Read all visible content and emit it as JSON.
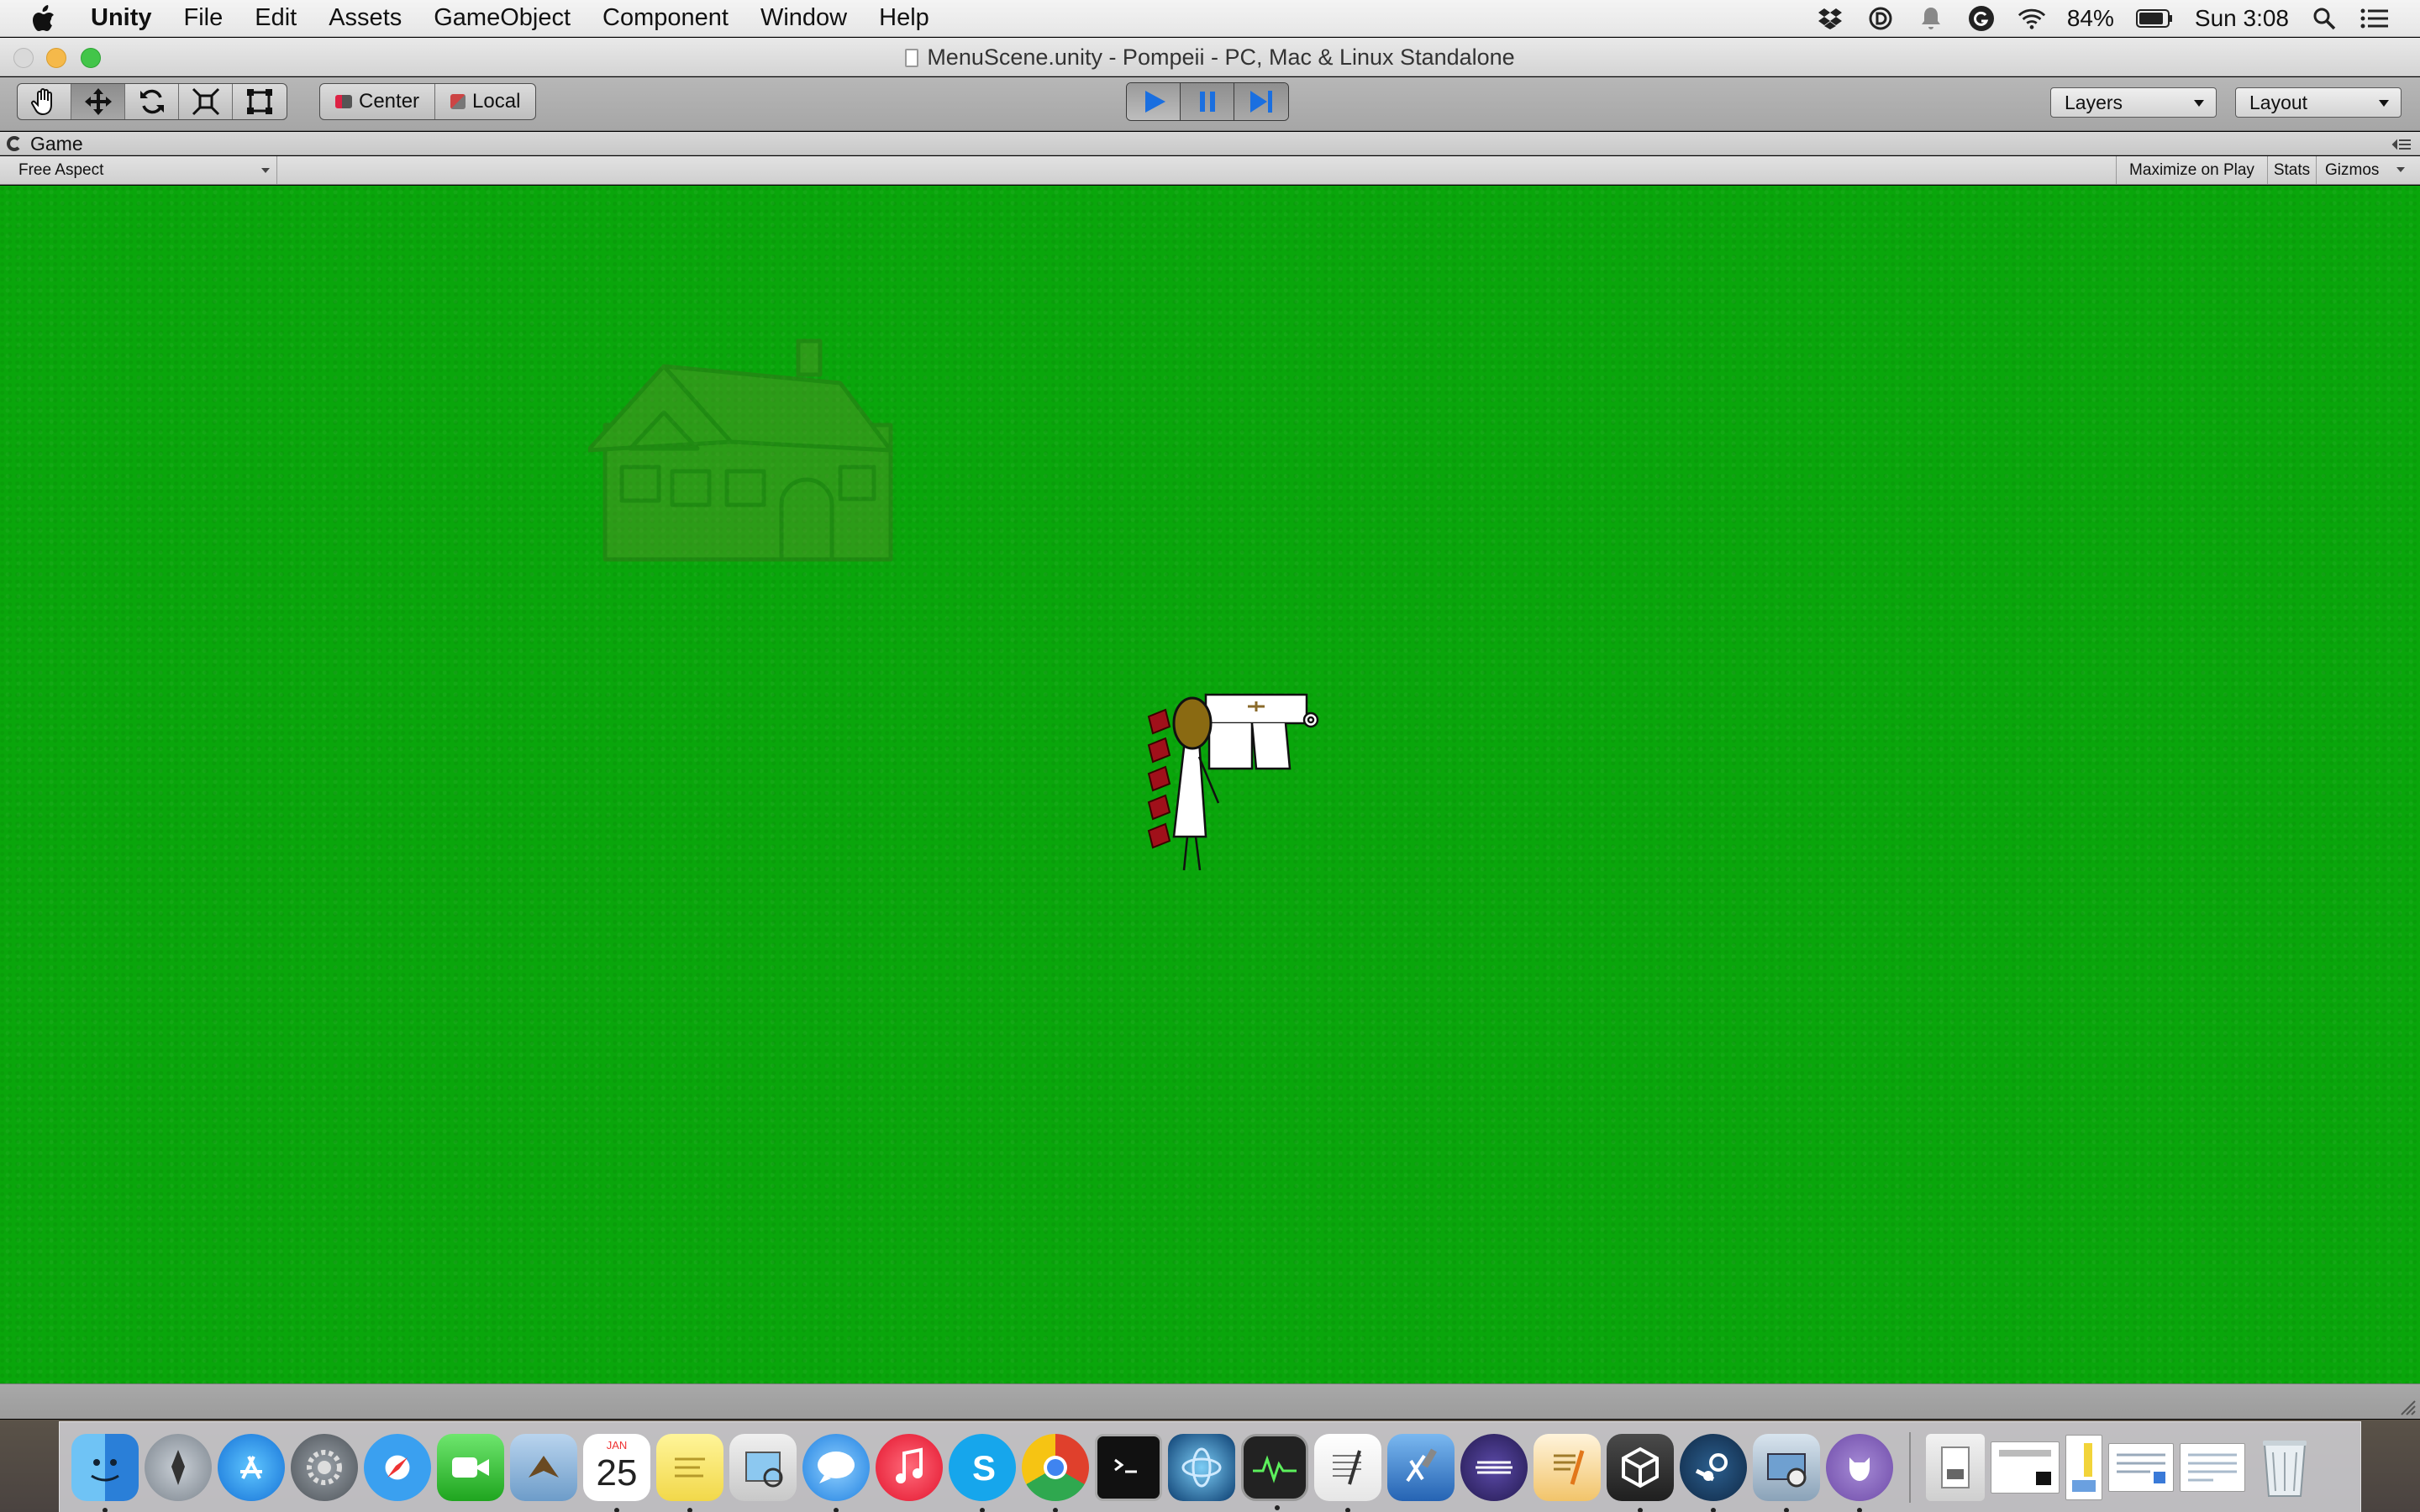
{
  "menubar": {
    "app_name": "Unity",
    "menus": [
      "File",
      "Edit",
      "Assets",
      "GameObject",
      "Component",
      "Window",
      "Help"
    ],
    "battery_percent": "84%",
    "clock": "Sun 3:08"
  },
  "window": {
    "title": "MenuScene.unity - Pompeii - PC, Mac & Linux Standalone"
  },
  "toolbar": {
    "pivot_label": "Center",
    "space_label": "Local",
    "layers_label": "Layers",
    "layout_label": "Layout",
    "play_state": "playing"
  },
  "game_view": {
    "tab_label": "Game",
    "aspect_label": "Free Aspect",
    "maximize_label": "Maximize on Play",
    "stats_label": "Stats",
    "gizmos_label": "Gizmos",
    "background_color": "#09a60b"
  },
  "dock": {
    "calendar_month": "JAN",
    "calendar_day": "25"
  }
}
